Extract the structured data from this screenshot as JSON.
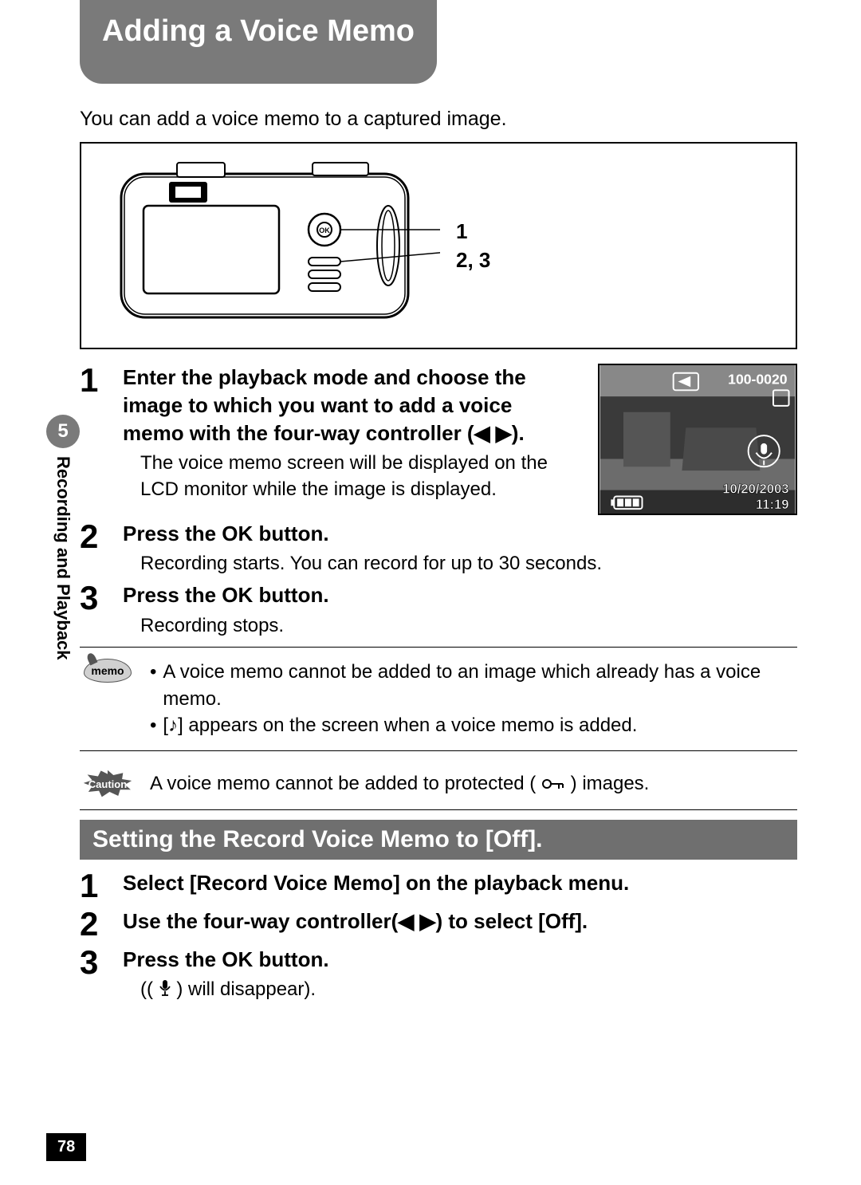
{
  "sidebar": {
    "chapter_number": "5",
    "chapter_label": "Recording and Playback"
  },
  "page_number": "78",
  "title": "Adding a Voice Memo",
  "intro": "You can add a voice memo to a captured image.",
  "callout": {
    "line1": "1",
    "line2": "2, 3"
  },
  "screen_preview": {
    "file_number": "100-0020",
    "date": "10/20/2003",
    "time": "11:19"
  },
  "steps_a": [
    {
      "num": "1",
      "title": "Enter the playback mode and choose the image to which you want to add a voice memo with the four-way controller (◀ ▶).",
      "desc": "The voice memo screen will be displayed on the LCD monitor while the image is displayed."
    },
    {
      "num": "2",
      "title": "Press the OK button.",
      "desc": "Recording starts. You can record for up to 30 seconds."
    },
    {
      "num": "3",
      "title": "Press the OK button.",
      "desc": "Recording stops."
    }
  ],
  "memo_label": "memo",
  "memo_notes": [
    "A voice memo cannot be added to an image which already has a voice memo.",
    "[♪] appears on the screen when a voice memo is added."
  ],
  "caution_label": "Caution",
  "caution_text_before": "A voice memo cannot be added to protected (",
  "caution_text_after": ") images.",
  "section2_title": "Setting the Record Voice Memo to [Off].",
  "steps_b": [
    {
      "num": "1",
      "title": "Select [Record Voice Memo] on the playback menu."
    },
    {
      "num": "2",
      "title": "Use the four-way controller(◀ ▶) to select [Off]."
    },
    {
      "num": "3",
      "title": "Press the OK button.",
      "desc_before": "((",
      "desc_after": ") will disappear)."
    }
  ]
}
